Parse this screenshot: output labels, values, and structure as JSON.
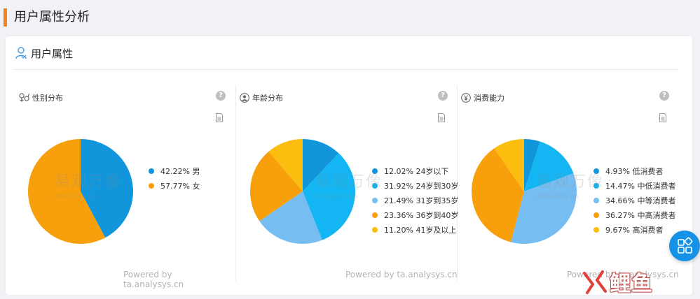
{
  "page": {
    "title": "用户属性分析"
  },
  "card": {
    "title": "用户属性"
  },
  "watermark": {
    "cn": "易观万像",
    "en": "Analysys.cn"
  },
  "panels": [
    {
      "title": "性别分布",
      "powered": "Powered by ta.analysys.cn",
      "items": [
        {
          "label": "42.22%  男",
          "value": 42.22,
          "color": "#1296db"
        },
        {
          "label": "57.77%  女",
          "value": 57.77,
          "color": "#f8a00c"
        }
      ]
    },
    {
      "title": "年龄分布",
      "powered": "Powered by ta.analysys.cn",
      "items": [
        {
          "label": "12.02%  24岁以下",
          "value": 12.02,
          "color": "#1296db"
        },
        {
          "label": "31.92%  24岁到30岁",
          "value": 31.92,
          "color": "#13b5f2"
        },
        {
          "label": "21.49%  31岁到35岁",
          "value": 21.49,
          "color": "#76bdf2"
        },
        {
          "label": "23.36%  36岁到40岁",
          "value": 23.36,
          "color": "#f8a00c"
        },
        {
          "label": "11.20%  41岁及以上",
          "value": 11.2,
          "color": "#fbbd0e"
        }
      ]
    },
    {
      "title": "消费能力",
      "powered": "Powered by ta.analysys.cn",
      "items": [
        {
          "label": "4.93%  低消费者",
          "value": 4.93,
          "color": "#1296db"
        },
        {
          "label": "14.47%  中低消费者",
          "value": 14.47,
          "color": "#13b5f2"
        },
        {
          "label": "34.66%  中等消费者",
          "value": 34.66,
          "color": "#76bdf2"
        },
        {
          "label": "36.27%  中高消费者",
          "value": 36.27,
          "color": "#f8a00c"
        },
        {
          "label": "9.67%  高消费者",
          "value": 9.67,
          "color": "#fbbd0e"
        }
      ]
    }
  ],
  "brand": {
    "text": "鲤鱼"
  },
  "colors": {
    "accent": "#f5841f",
    "float_button": "#1592e6"
  }
}
